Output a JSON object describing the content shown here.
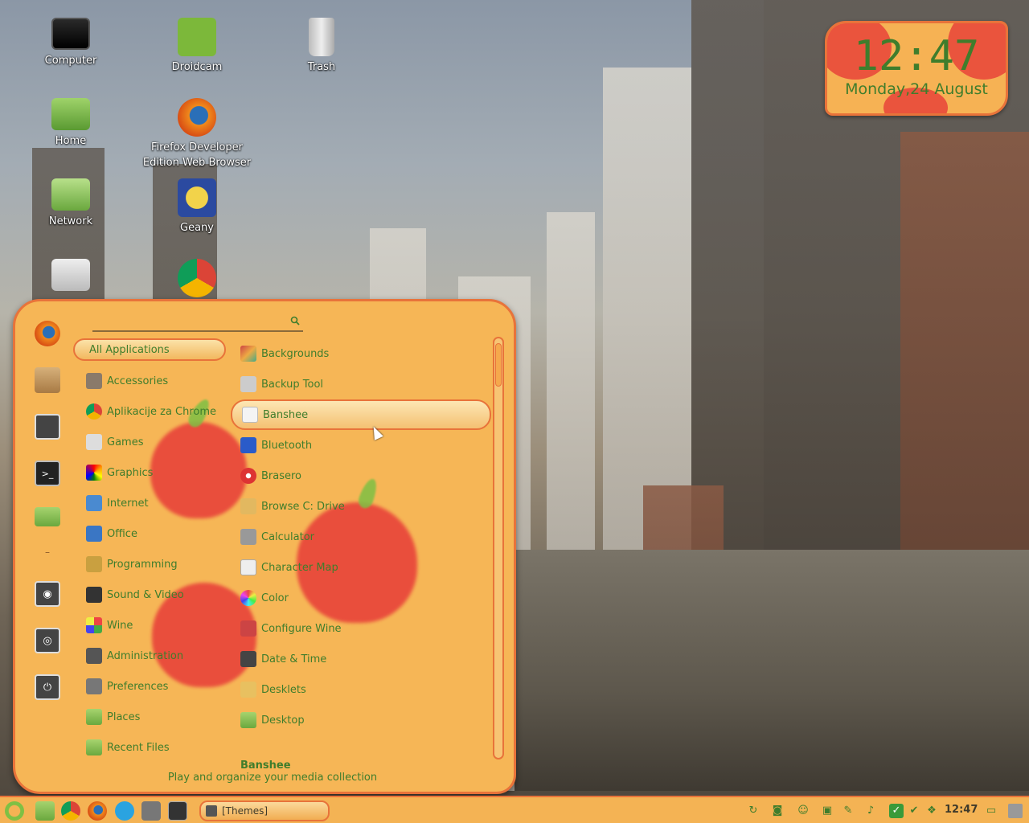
{
  "desktop": {
    "icons": [
      {
        "label": "Computer",
        "icon": "computer-icon"
      },
      {
        "label": "Droidcam",
        "icon": "droidcam-icon"
      },
      {
        "label": "Trash",
        "icon": "trash-icon"
      },
      {
        "label": "Home",
        "icon": "home-folder-icon"
      },
      {
        "label": "Firefox Developer Edition Web Browser",
        "icon": "firefox-icon"
      },
      {
        "label": "Network",
        "icon": "network-icon"
      },
      {
        "label": "Geany",
        "icon": "geany-icon"
      },
      {
        "label": "",
        "icon": "usb-drive-icon"
      },
      {
        "label": "",
        "icon": "chrome-icon"
      }
    ]
  },
  "clock": {
    "time": "12:47",
    "date": "Monday,24 August"
  },
  "menu": {
    "search": {
      "value": "",
      "placeholder": ""
    },
    "favorites": [
      "firefox-icon",
      "package-manager-icon",
      "settings-icon",
      "terminal-icon",
      "folder-icon",
      "lock-screen-icon",
      "logout-icon",
      "shutdown-icon"
    ],
    "categories": [
      {
        "label": "All Applications",
        "icon": ""
      },
      {
        "label": "Accessories",
        "icon": "accessories-icon"
      },
      {
        "label": "Aplikacije za Chrome",
        "icon": "chrome-apps-icon"
      },
      {
        "label": "Games",
        "icon": "games-icon"
      },
      {
        "label": "Graphics",
        "icon": "graphics-icon"
      },
      {
        "label": "Internet",
        "icon": "internet-icon"
      },
      {
        "label": "Office",
        "icon": "office-icon"
      },
      {
        "label": "Programming",
        "icon": "programming-icon"
      },
      {
        "label": "Sound & Video",
        "icon": "sound-video-icon"
      },
      {
        "label": "Wine",
        "icon": "wine-icon"
      },
      {
        "label": "Administration",
        "icon": "administration-icon"
      },
      {
        "label": "Preferences",
        "icon": "preferences-icon"
      },
      {
        "label": "Places",
        "icon": "places-icon"
      },
      {
        "label": "Recent Files",
        "icon": "recent-files-icon"
      }
    ],
    "apps": [
      {
        "label": "Backgrounds",
        "icon": "backgrounds-icon"
      },
      {
        "label": "Backup Tool",
        "icon": "backup-tool-icon"
      },
      {
        "label": "Banshee",
        "icon": "banshee-icon"
      },
      {
        "label": "Bluetooth",
        "icon": "bluetooth-icon"
      },
      {
        "label": "Brasero",
        "icon": "brasero-icon"
      },
      {
        "label": "Browse C: Drive",
        "icon": "browse-drive-icon"
      },
      {
        "label": "Calculator",
        "icon": "calculator-icon"
      },
      {
        "label": "Character Map",
        "icon": "character-map-icon"
      },
      {
        "label": "Color",
        "icon": "color-icon"
      },
      {
        "label": "Configure Wine",
        "icon": "configure-wine-icon"
      },
      {
        "label": "Date & Time",
        "icon": "date-time-icon"
      },
      {
        "label": "Desklets",
        "icon": "desklets-icon"
      },
      {
        "label": "Desktop",
        "icon": "desktop-icon"
      }
    ],
    "selected_app": {
      "name": "Banshee",
      "description": "Play and organize your media collection"
    }
  },
  "taskbar": {
    "window_button": "[Themes]",
    "clock": "12:47"
  },
  "colors": {
    "accent": "#e8733a",
    "panel": "#f6b656",
    "text": "#3f7d2c",
    "apple": "#e8433a"
  }
}
